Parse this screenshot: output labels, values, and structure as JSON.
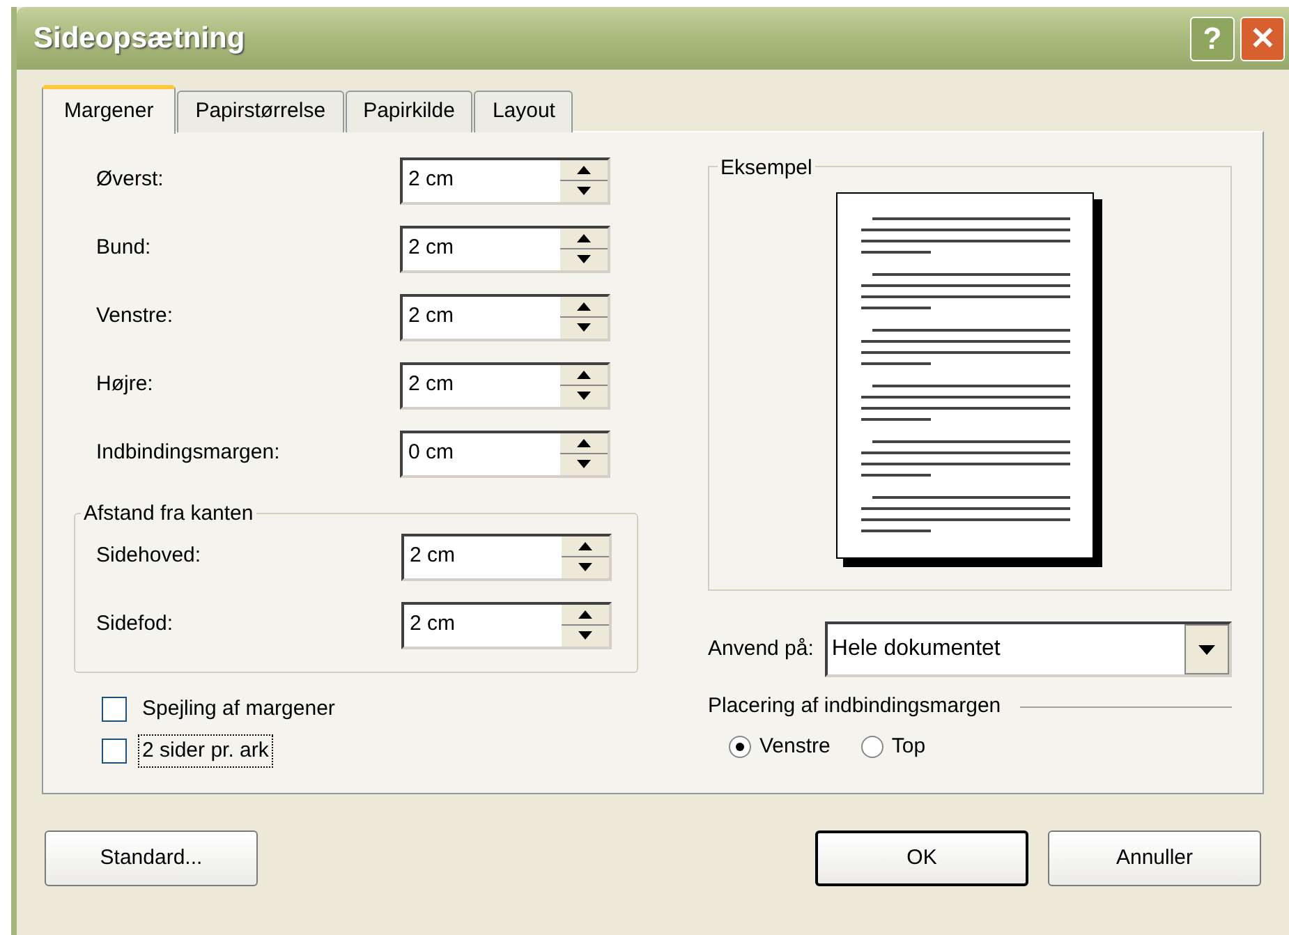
{
  "window": {
    "title": "Sideopsætning",
    "buttons": [
      {
        "kind": "help",
        "glyph": "?"
      },
      {
        "kind": "close",
        "glyph": "✕"
      }
    ]
  },
  "tabs": [
    {
      "label": "Margener",
      "selected": true
    },
    {
      "label": "Papirstørrelse",
      "selected": false
    },
    {
      "label": "Papirkilde",
      "selected": false
    },
    {
      "label": "Layout",
      "selected": false
    }
  ],
  "margins": [
    {
      "label": "Øverst:",
      "value": "2 cm"
    },
    {
      "label": "Bund:",
      "value": "2 cm"
    },
    {
      "label": "Venstre:",
      "value": "2 cm"
    },
    {
      "label": "Højre:",
      "value": "2 cm"
    },
    {
      "label": "Indbindingsmargen:",
      "value": "0 cm"
    }
  ],
  "edge_distance": {
    "title": "Afstand fra kanten",
    "fields": [
      {
        "label": "Sidehoved:",
        "value": "2 cm"
      },
      {
        "label": "Sidefod:",
        "value": "2 cm"
      }
    ]
  },
  "options": [
    {
      "label": "Spejling af margener",
      "checked": false,
      "focused": false
    },
    {
      "label": "2 sider pr. ark",
      "checked": false,
      "focused": true
    }
  ],
  "preview": {
    "title": "Eksempel"
  },
  "apply_to": {
    "label": "Anvend på:",
    "value": "Hele dokumentet"
  },
  "gutter_position": {
    "title": "Placering af indbindingsmargen",
    "options": [
      {
        "label": "Venstre",
        "selected": true
      },
      {
        "label": "Top",
        "selected": false
      }
    ]
  },
  "buttons": [
    {
      "label": "Standard...",
      "default": false
    },
    {
      "label": "OK",
      "default": true
    },
    {
      "label": "Annuller",
      "default": false
    }
  ]
}
